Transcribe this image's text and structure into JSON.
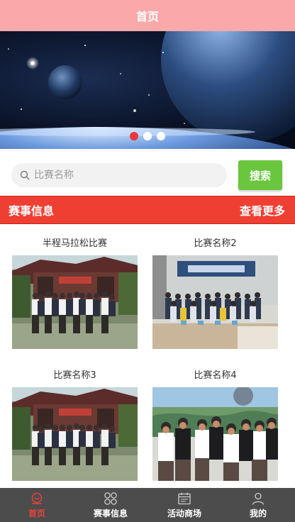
{
  "header": {
    "title": "首页"
  },
  "banner": {
    "dots": [
      {
        "active": true
      },
      {
        "active": false
      },
      {
        "active": false
      }
    ]
  },
  "search": {
    "placeholder": "比赛名称",
    "button_label": "搜索"
  },
  "section": {
    "title": "赛事信息",
    "more_label": "查看更多"
  },
  "events": [
    {
      "title": "半程马拉松比赛"
    },
    {
      "title": "比赛名称2"
    },
    {
      "title": "比赛名称3"
    },
    {
      "title": "比赛名称4"
    }
  ],
  "bottom_nav": {
    "items": [
      {
        "label": "首页",
        "icon": "home-icon",
        "active": true
      },
      {
        "label": "赛事信息",
        "icon": "grid-icon",
        "active": false
      },
      {
        "label": "活动商场",
        "icon": "calendar-icon",
        "active": false
      },
      {
        "label": "我的",
        "icon": "user-icon",
        "active": false
      }
    ]
  },
  "colors": {
    "title_bar": "#f9a9a9",
    "section_header": "#ef3f33",
    "search_button": "#6ac63f",
    "nav_background": "#4c4c4c",
    "nav_active": "#e8433a"
  }
}
